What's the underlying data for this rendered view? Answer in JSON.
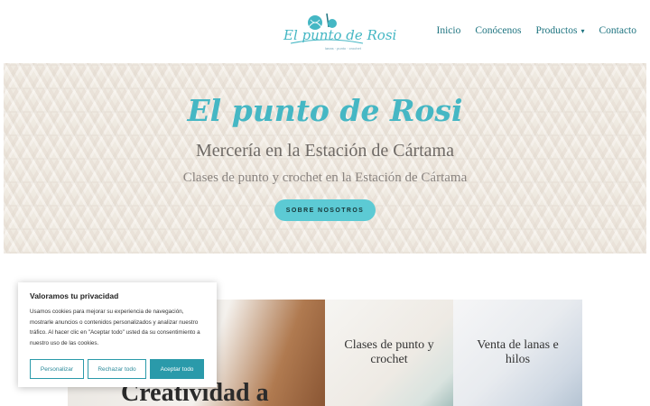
{
  "header": {
    "logo_text": "El punto de Rosi",
    "logo_sub": "lanas · punto · crochet",
    "nav": [
      {
        "label": "Inicio"
      },
      {
        "label": "Conócenos"
      },
      {
        "label": "Productos",
        "icon": "chevron-down-icon"
      },
      {
        "label": "Contacto"
      }
    ]
  },
  "hero": {
    "title": "El punto de Rosi",
    "subtitle": "Mercería en la Estación de Cártama",
    "subtitle2": "Clases de punto y crochet en la Estación de Cártama",
    "button": "SOBRE NOSOTROS"
  },
  "content": {
    "big_title": "Creatividad a",
    "card_mid": "Clases de punto y crochet",
    "card_right": "Venta de lanas e hilos"
  },
  "cookie": {
    "title": "Valoramos tu privacidad",
    "text": "Usamos cookies para mejorar su experiencia de navegación, mostrarle anuncios o contenidos personalizados y analizar nuestro tráfico. Al hacer clic en \"Aceptar todo\" usted da su consentimiento a nuestro uso de las cookies.",
    "btn_customize": "Personalizar",
    "btn_reject": "Rechazar todo",
    "btn_accept": "Aceptar todo"
  },
  "colors": {
    "accent": "#45b7c4",
    "button": "#5ccad4",
    "nav_text": "#1e7480"
  }
}
